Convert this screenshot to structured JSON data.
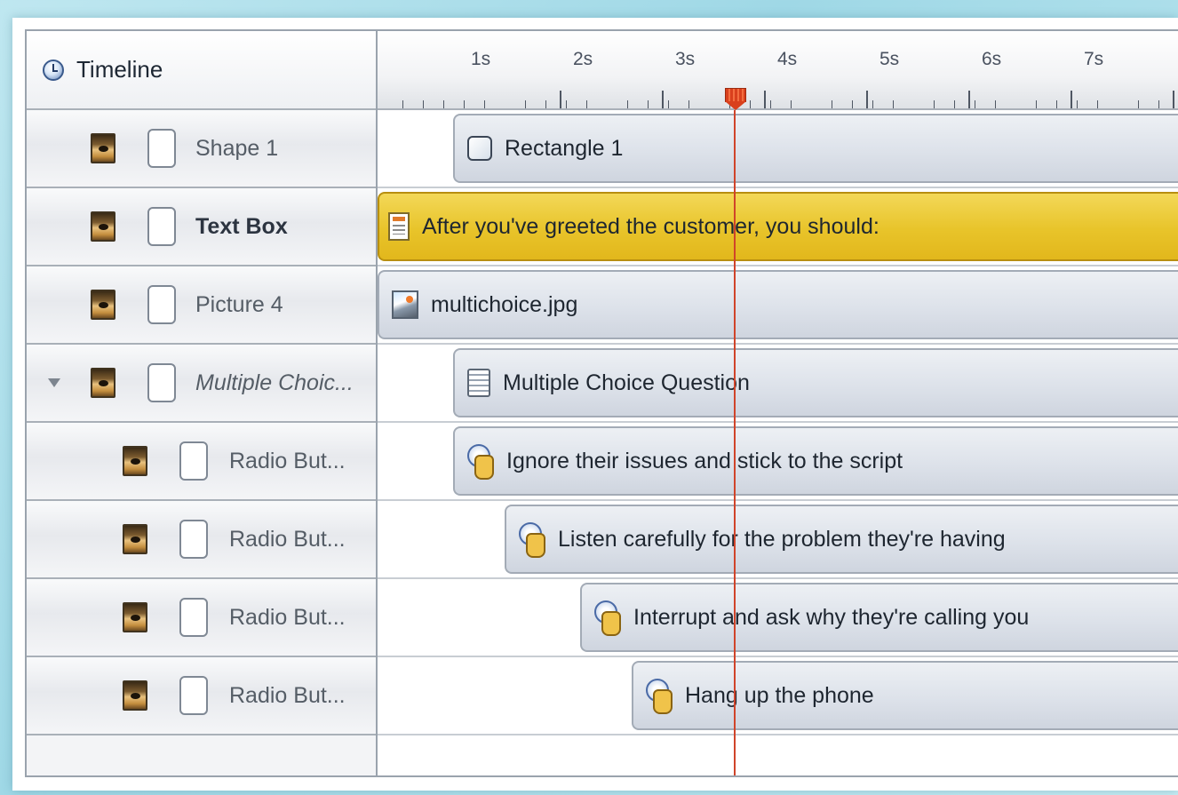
{
  "header": {
    "title": "Timeline"
  },
  "ruler": {
    "ticks": [
      "1s",
      "2s",
      "3s",
      "4s",
      "5s",
      "6s",
      "7s"
    ]
  },
  "rows": [
    {
      "name": "Shape 1",
      "bar_label": "Rectangle 1",
      "icon": "rectangle-shape-icon"
    },
    {
      "name": "Text Box",
      "bar_label": "After you've greeted the customer, you should:",
      "icon": "text-box-icon",
      "selected": true
    },
    {
      "name": "Picture 4",
      "bar_label": "multichoice.jpg",
      "icon": "picture-icon"
    },
    {
      "name": "Multiple Choic...",
      "bar_label": "Multiple Choice Question",
      "icon": "multiple-choice-icon",
      "expanded": true
    },
    {
      "name": "Radio But...",
      "bar_label": "Ignore their issues and stick to the script",
      "icon": "radio-button-icon"
    },
    {
      "name": "Radio But...",
      "bar_label": "Listen carefully for the problem they're having",
      "icon": "radio-button-icon"
    },
    {
      "name": "Radio But...",
      "bar_label": "Interrupt and ask why they're calling you",
      "icon": "radio-button-icon"
    },
    {
      "name": "Radio But...",
      "bar_label": "Hang up the phone",
      "icon": "radio-button-icon"
    }
  ],
  "colors": {
    "selected_bar": "#e8c42a",
    "playhead": "#d9401d"
  }
}
